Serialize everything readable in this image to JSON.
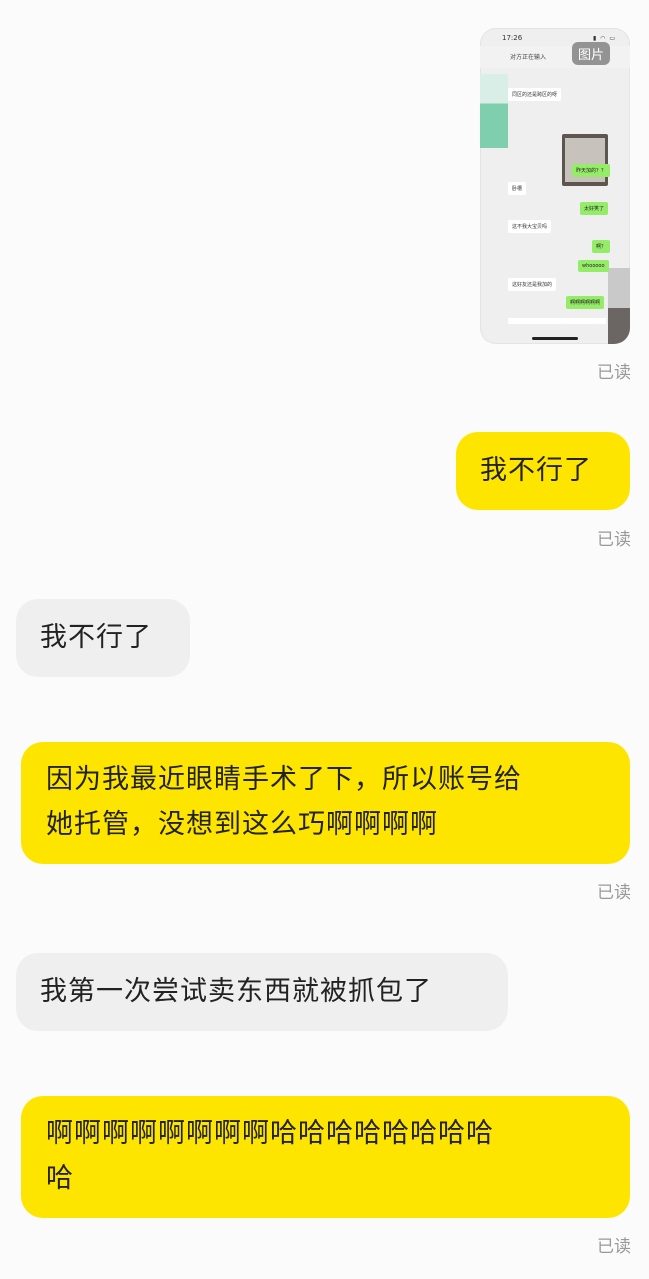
{
  "thumbnail": {
    "status_time": "17:26",
    "status_icons": "▮ ◠ ▭",
    "topbar_title": "对方正在输入",
    "badge": "图片",
    "mini_messages": [
      {
        "text": "同区的还是跨区的呀",
        "side": "in"
      },
      {
        "text": "昨天加的？？",
        "side": "out"
      },
      {
        "text": "卧槽",
        "side": "in"
      },
      {
        "text": "太好笑了",
        "side": "out"
      },
      {
        "text": "这不我大宝贝吗",
        "side": "in"
      },
      {
        "text": "啊？",
        "side": "out"
      },
      {
        "text": "whooooo",
        "side": "out"
      },
      {
        "text": "这好友还是我加的",
        "side": "in"
      },
      {
        "text": "啊啊啊啊啊啊",
        "side": "out"
      }
    ]
  },
  "messages": [
    {
      "side": "me",
      "type": "image",
      "read": "已读"
    },
    {
      "side": "me",
      "text": "我不行了",
      "read": "已读"
    },
    {
      "side": "other",
      "text": "我不行了"
    },
    {
      "side": "me",
      "lines": [
        "因为我最近眼睛手术了下，所以账号给",
        "她托管，没想到这么巧啊啊啊啊"
      ],
      "read": "已读"
    },
    {
      "side": "other",
      "text": "我第一次尝试卖东西就被抓包了"
    },
    {
      "side": "me",
      "lines": [
        "啊啊啊啊啊啊啊啊哈哈哈哈哈哈哈哈",
        "哈"
      ],
      "read": "已读"
    }
  ],
  "colors": {
    "background": "#fbfbfb",
    "my_bubble": "#fee500",
    "other_bubble": "#efefef",
    "read_label": "#999999"
  }
}
